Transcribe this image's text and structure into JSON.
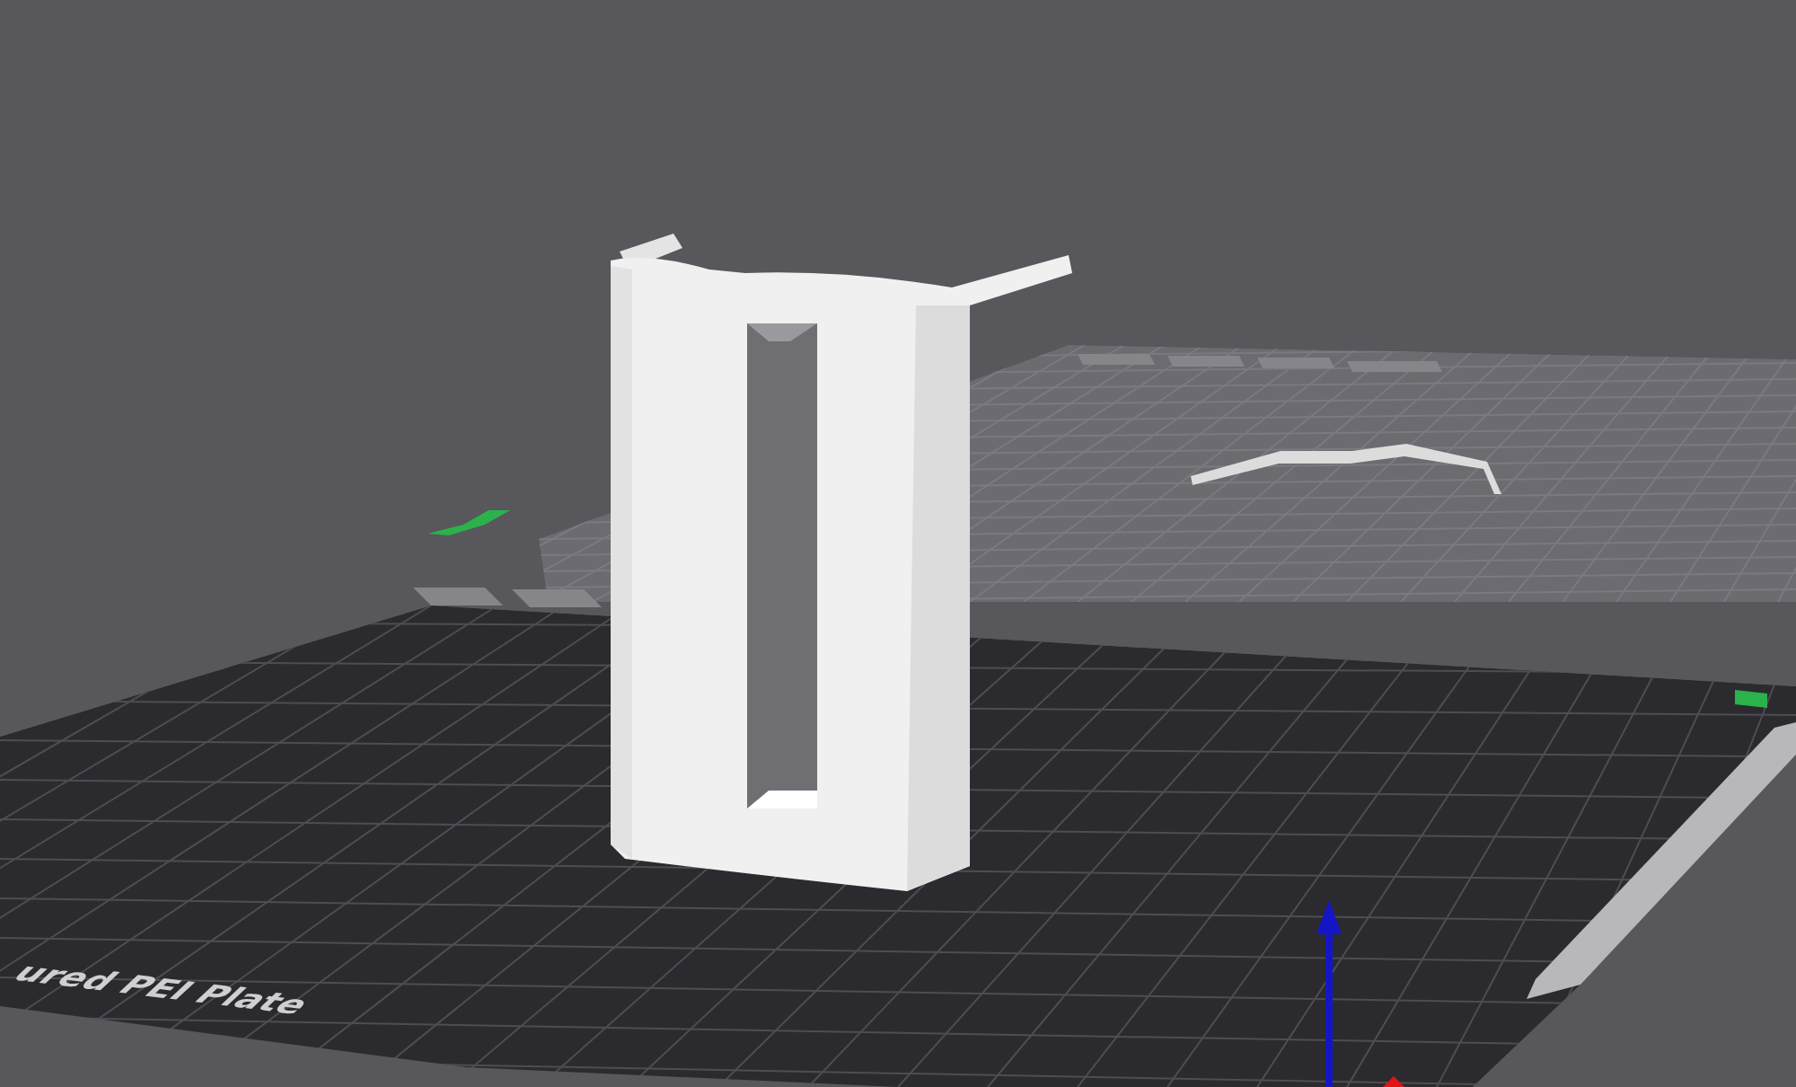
{
  "viewport": {
    "plate_label": "ured PEI Plate"
  }
}
